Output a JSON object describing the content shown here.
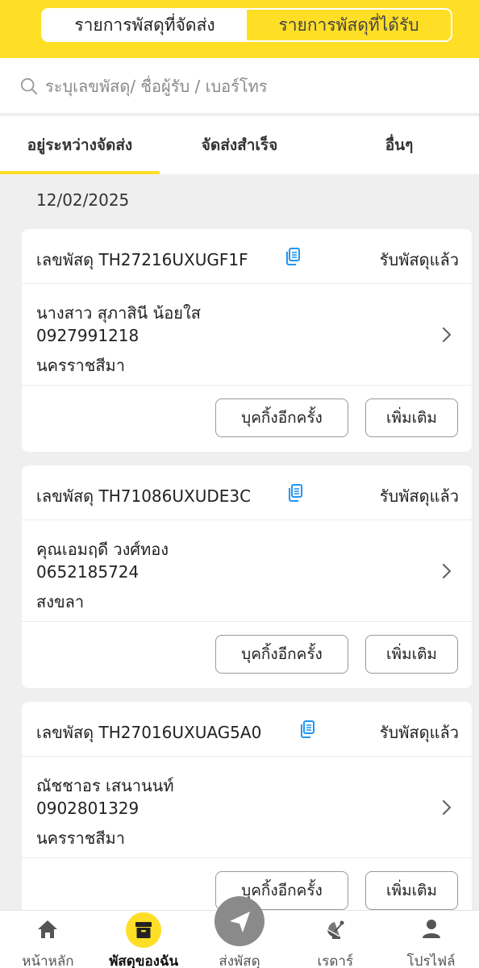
{
  "segment_tabs": [
    {
      "label": "รายการพัสดุที่จัดส่ง",
      "active": true
    },
    {
      "label": "รายการพัสดุที่ได้รับ",
      "active": false
    }
  ],
  "search": {
    "placeholder": "ระบุเลขพัสดุ/ ชื่อผู้รับ / เบอร์โทร"
  },
  "status_tabs": [
    {
      "label": "อยู่ระหว่างจัดส่ง",
      "active": true
    },
    {
      "label": "จัดส่งสำเร็จ",
      "active": false
    },
    {
      "label": "อื่นๆ",
      "active": false
    }
  ],
  "date": "12/02/2025",
  "parcels": [
    {
      "tracking_label": "เลขพัสดุ TH27216UXUGF1F",
      "status": "รับพัสดุแล้ว",
      "recipient": "นางสาว สุภาสินี น้อยใส",
      "phone": "0927991218",
      "province": "นครราชสีมา"
    },
    {
      "tracking_label": "เลขพัสดุ TH71086UXUDE3C",
      "status": "รับพัสดุแล้ว",
      "recipient": "คุณเอมฤดี วงศ์ทอง",
      "phone": "0652185724",
      "province": "สงขลา"
    },
    {
      "tracking_label": "เลขพัสดุ TH27016UXUAG5A0",
      "status": "รับพัสดุแล้ว",
      "recipient": "ณัชชาอร เสนานนท์",
      "phone": "0902801329",
      "province": "นครราชสีมา"
    }
  ],
  "card_buttons": {
    "rebook": "บุคกิ้งอีกครั้ง",
    "more": "เพิ่มเติม"
  },
  "bottom_nav": [
    {
      "label": "หน้าหลัก",
      "icon": "home-icon",
      "active": false
    },
    {
      "label": "พัสดุของฉัน",
      "icon": "box-icon",
      "active": true
    },
    {
      "label": "ส่งพัสดุ",
      "icon": "send-icon",
      "active": false
    },
    {
      "label": "เรดาร์",
      "icon": "radar-icon",
      "active": false
    },
    {
      "label": "โปรไฟล์",
      "icon": "profile-icon",
      "active": false
    }
  ],
  "colors": {
    "brand_yellow": "#ffde26",
    "copy_icon": "#2196f3",
    "send_button": "#8a8a8a"
  }
}
